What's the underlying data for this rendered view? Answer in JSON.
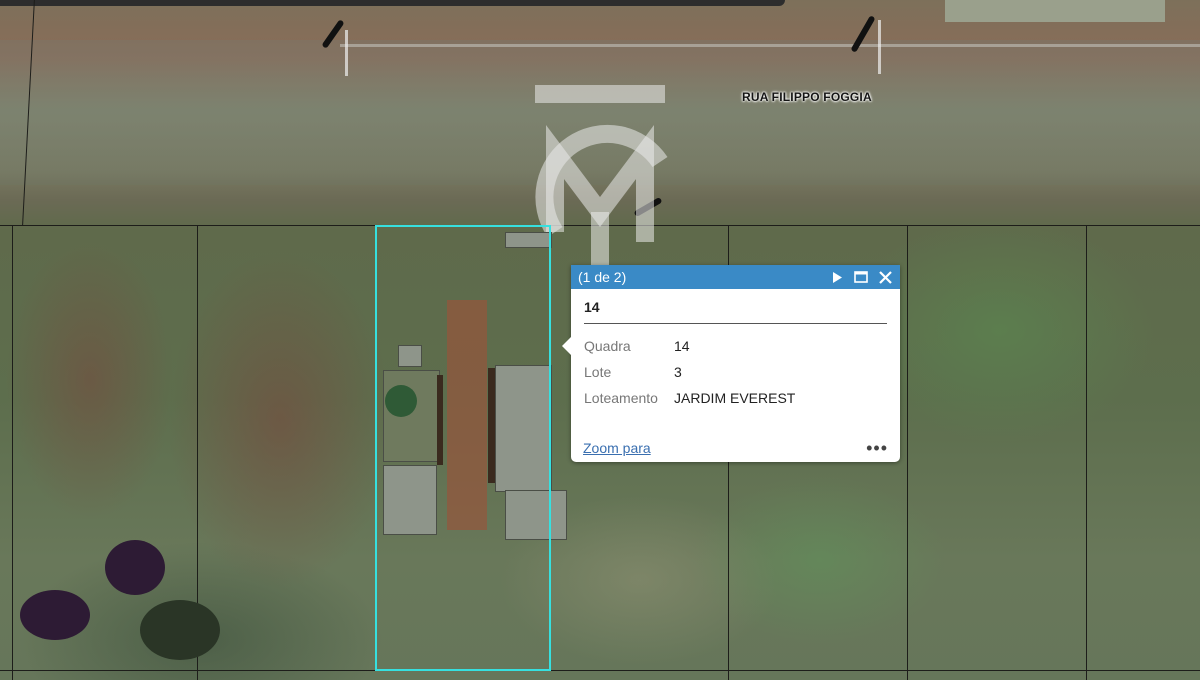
{
  "map": {
    "street_label": "RUA FILIPPO FOGGIA",
    "parcel_highlight_color": "#36e0df",
    "watermark_icon": "municipal-logo-watermark"
  },
  "popup": {
    "pager": "(1 de 2)",
    "header_color": "#3a8ac6",
    "next_icon": "play-triangle-icon",
    "maximize_icon": "maximize-icon",
    "close_icon": "close-icon",
    "title": "14",
    "attributes": [
      {
        "key": "Quadra",
        "value": "14"
      },
      {
        "key": "Lote",
        "value": "3"
      },
      {
        "key": "Loteamento",
        "value": "JARDIM EVEREST"
      }
    ],
    "zoom_label": "Zoom para",
    "more_label": "•••",
    "link_color": "#3a6fb0"
  }
}
